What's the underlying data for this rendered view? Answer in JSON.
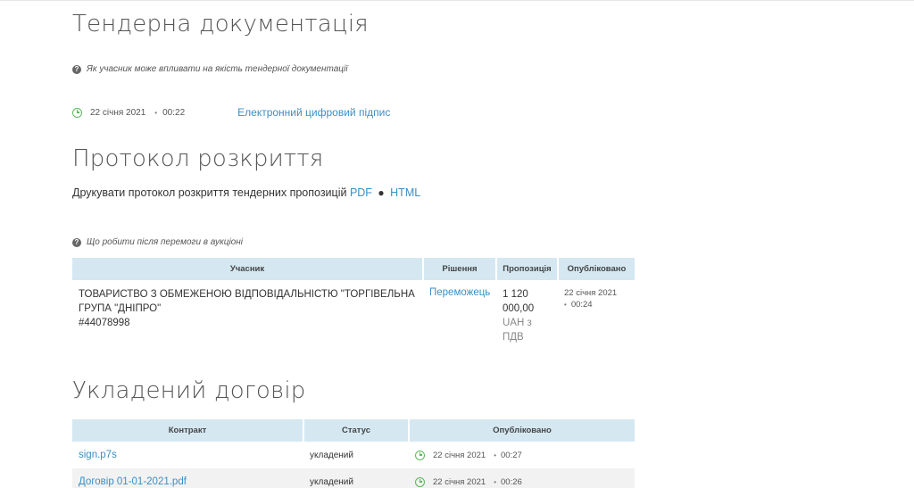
{
  "tender_docs": {
    "title": "Тендерна документація",
    "hint": "Як учасник може впливати на якість тендерної документації",
    "date": "22 січня 2021",
    "time": "00:22",
    "signature_link": "Електронний цифровий підпис"
  },
  "protocol": {
    "title": "Протокол розкриття",
    "print_text": "Друкувати протокол розкриття тендерних пропозицій",
    "pdf_link": "PDF",
    "html_link": "HTML",
    "hint": "Що робити після перемоги в аукціоні",
    "columns": [
      "Учасник",
      "Рішення",
      "Пропозиція",
      "Опубліковано"
    ],
    "rows": [
      {
        "name_line1": "ТОВАРИСТВО З ОБМЕЖЕНОЮ ВІДПОВІДАЛЬНІСТЮ \"ТОРГІВЕЛЬНА",
        "name_line2": "ГРУПА \"ДНІПРО\"",
        "code": "#44078998",
        "decision": "Переможець",
        "price_line1": "1 120",
        "price_line2": "000,00",
        "currency_line1": "UAH з",
        "currency_line2": "ПДВ",
        "pub_date": "22 січня 2021",
        "pub_time": "00:24"
      }
    ]
  },
  "contract": {
    "title": "Укладений договір",
    "columns": [
      "Контракт",
      "Статус",
      "Опубліковано"
    ],
    "rows": [
      {
        "file": "sign.p7s",
        "status": "укладений",
        "date": "22 січня 2021",
        "time": "00:27"
      },
      {
        "file": "Договір 01-01-2021.pdf",
        "status": "укладений",
        "date": "22 січня 2021",
        "time": "00:26"
      }
    ]
  },
  "colors": {
    "link": "#3b8fc4",
    "table_header": "#d5e8f2",
    "clock_icon": "#5cb85c"
  }
}
